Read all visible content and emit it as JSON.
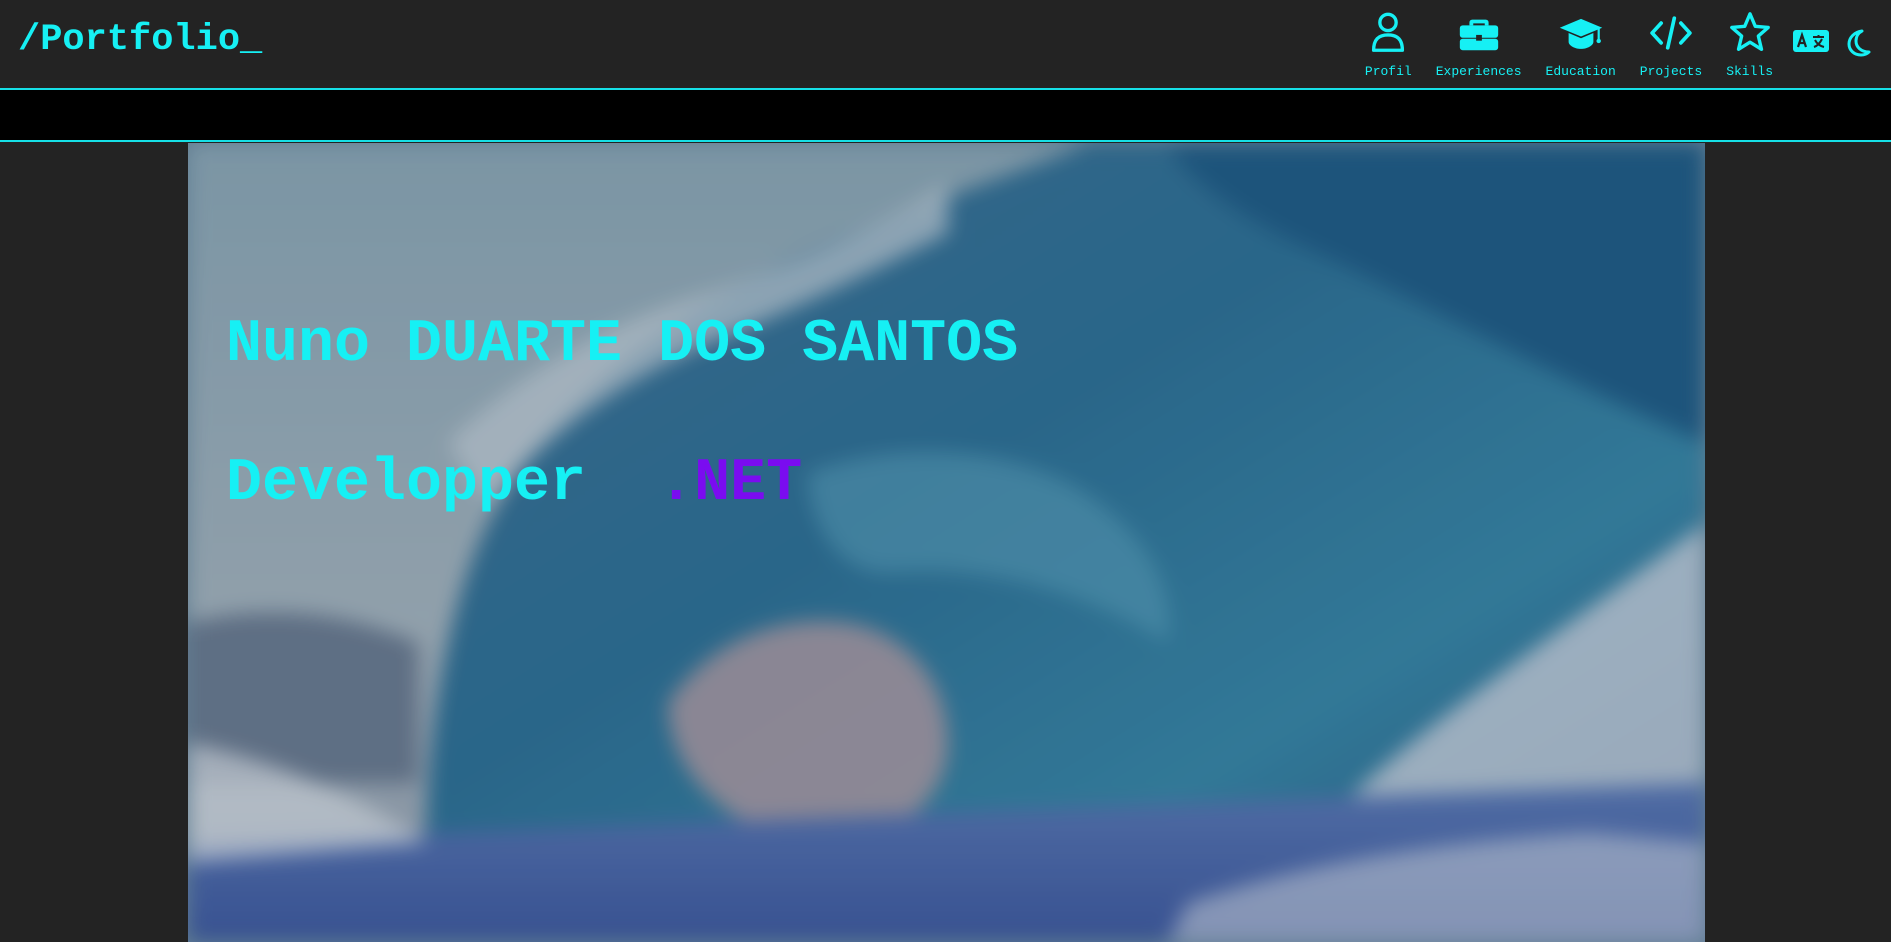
{
  "navbar": {
    "brand": "/Portfolio_",
    "items": [
      {
        "label": "Profil",
        "icon": "user-icon"
      },
      {
        "label": "Experiences",
        "icon": "briefcase-icon"
      },
      {
        "label": "Education",
        "icon": "graduation-cap-icon"
      },
      {
        "label": "Projects",
        "icon": "code-icon"
      },
      {
        "label": "Skills",
        "icon": "star-icon"
      }
    ],
    "language_icon": "translate-icon",
    "theme_icon": "moon-icon"
  },
  "hero": {
    "name": "Nuno DUARTE DOS SANTOS",
    "role": "Developper  ",
    "tech": ".NET",
    "background": "ocean-wave-image"
  },
  "colors": {
    "accent": "#16f0f4",
    "tech": "#7a0cf0",
    "background": "#232323",
    "band": "#000000"
  }
}
